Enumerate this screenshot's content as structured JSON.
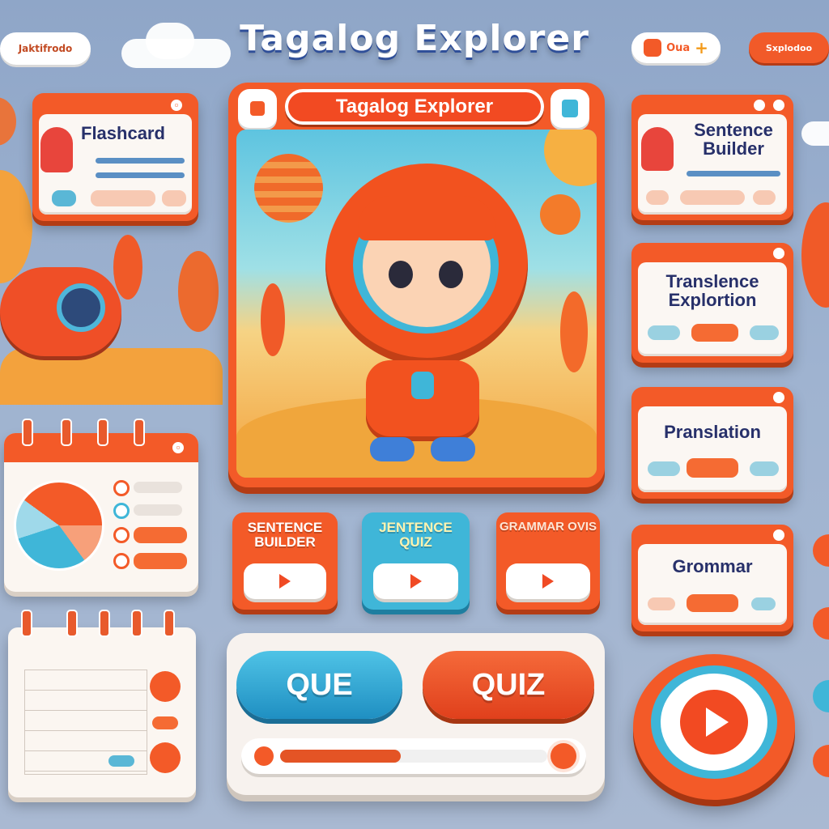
{
  "header": {
    "title": "Tagalog Explorer"
  },
  "top_pills": {
    "left": "Jaktifrodo",
    "right_1": "Oua",
    "right_1_plus": "+",
    "right_2": "Sxplodoo"
  },
  "main_card": {
    "banner": "Tagalog Explorer"
  },
  "left_cards": {
    "flashcard": {
      "title": "Flashcard"
    }
  },
  "right_cards": [
    {
      "title": "Sentence Builder"
    },
    {
      "title": "Translence Explortion"
    },
    {
      "title": "Pranslation"
    },
    {
      "title": "Grommar"
    }
  ],
  "mini_cards": [
    {
      "title": "SENTENCE BUILDER",
      "color": "#f35a28"
    },
    {
      "title": "JENTENCE QUIZ",
      "color": "#3fb6d8"
    },
    {
      "title": "GRAMMAR OVIS",
      "color": "#f35a28"
    }
  ],
  "quiz_panel": {
    "btn_left": "QUE",
    "btn_right": "QUIZ",
    "progress": 0.45
  },
  "colors": {
    "accent": "#f35a28",
    "blue": "#3fb6d8",
    "navy": "#27306a"
  }
}
